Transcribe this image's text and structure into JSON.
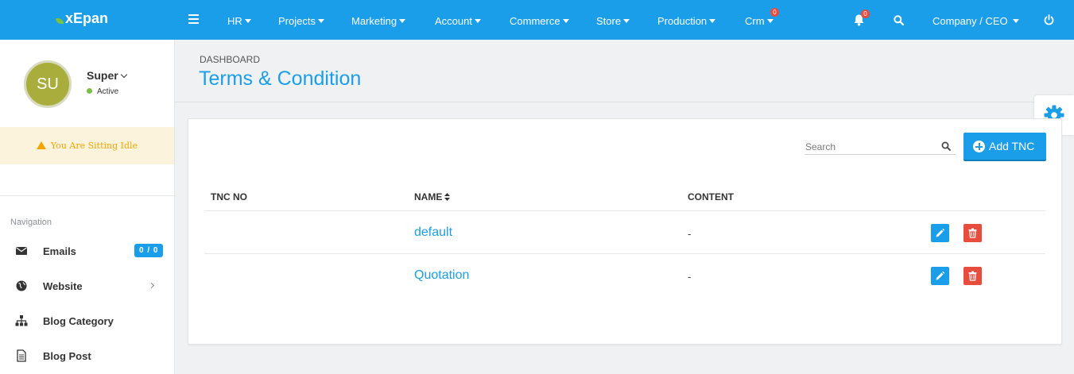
{
  "app": {
    "logo_text": "xEpan"
  },
  "topnav": {
    "items": [
      {
        "label": "HR"
      },
      {
        "label": "Projects"
      },
      {
        "label": "Marketing"
      },
      {
        "label": "Account"
      },
      {
        "label": "Commerce"
      },
      {
        "label": "Store"
      },
      {
        "label": "Production"
      },
      {
        "label": "Crm",
        "badge": "0"
      }
    ],
    "notification_badge": "0",
    "user_menu_label": "Company / CEO"
  },
  "sidebar": {
    "avatar_initials": "SU",
    "user_name": "Super",
    "user_status": "Active",
    "idle_message": "You Are Sitting Idle",
    "nav_heading": "Navigation",
    "items": [
      {
        "label": "Emails",
        "icon": "envelope-icon",
        "badge": "0 / 0"
      },
      {
        "label": "Website",
        "icon": "globe-icon"
      },
      {
        "label": "Blog Category",
        "icon": "sitemap-icon"
      },
      {
        "label": "Blog Post",
        "icon": "document-icon"
      }
    ]
  },
  "page": {
    "breadcrumb": "DASHBOARD",
    "title": "Terms & Condition"
  },
  "toolbar": {
    "search_placeholder": "Search",
    "add_button_label": "Add TNC"
  },
  "table": {
    "headers": {
      "tnc_no": "TNC NO",
      "name": "NAME",
      "content": "CONTENT"
    },
    "rows": [
      {
        "tnc_no": "",
        "name": "default",
        "content": "-"
      },
      {
        "tnc_no": "",
        "name": "Quotation",
        "content": "-"
      }
    ]
  },
  "colors": {
    "primary": "#1a9ee9",
    "danger": "#e74c3c",
    "warning": "#f0a500",
    "success": "#7bc043"
  }
}
